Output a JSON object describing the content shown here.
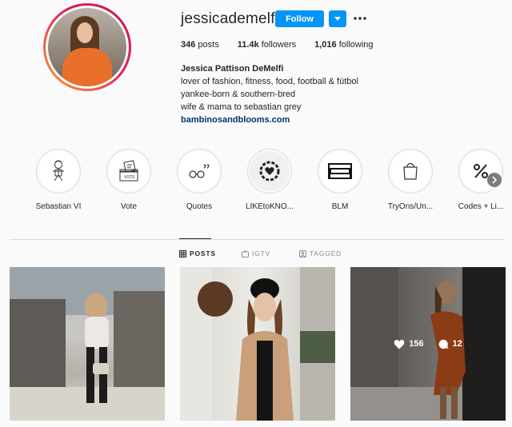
{
  "profile": {
    "username": "jessicademelfi",
    "follow_label": "Follow",
    "stats": [
      {
        "value": "346",
        "label": "posts"
      },
      {
        "value": "11.4k",
        "label": "followers"
      },
      {
        "value": "1,016",
        "label": "following"
      }
    ],
    "full_name": "Jessica Pattison DeMelfi",
    "bio_lines": [
      "lover of fashion, fitness, food, football & fútbol",
      "yankee-born & southern-bred",
      "wife & mama to sebastian grey"
    ],
    "website": "bambinosandblooms.com"
  },
  "highlights": [
    {
      "label": "Sebastian VI",
      "icon": "baby-drawing-icon"
    },
    {
      "label": "Vote",
      "icon": "ballot-box-icon"
    },
    {
      "label": "Quotes",
      "icon": "glasses-icon"
    },
    {
      "label": "LIKEtoKNO...",
      "icon": "heart-badge-icon"
    },
    {
      "label": "BLM",
      "icon": "blm-text-icon"
    },
    {
      "label": "TryOns/Un...",
      "icon": "shopping-bag-icon"
    },
    {
      "label": "Codes + Li...",
      "icon": "percent-icon"
    }
  ],
  "tabs": [
    {
      "label": "POSTS",
      "icon": "grid-icon",
      "active": true
    },
    {
      "label": "IGTV",
      "icon": "igtv-icon",
      "active": false
    },
    {
      "label": "TAGGED",
      "icon": "tagged-icon",
      "active": false
    }
  ],
  "posts": [
    {
      "description_icon": "photo"
    },
    {
      "description_icon": "photo"
    },
    {
      "likes": "156",
      "comments": "12"
    }
  ],
  "colors": {
    "accent": "#0095f6",
    "text": "#262626",
    "muted": "#8e8e8e",
    "link": "#00376b"
  }
}
